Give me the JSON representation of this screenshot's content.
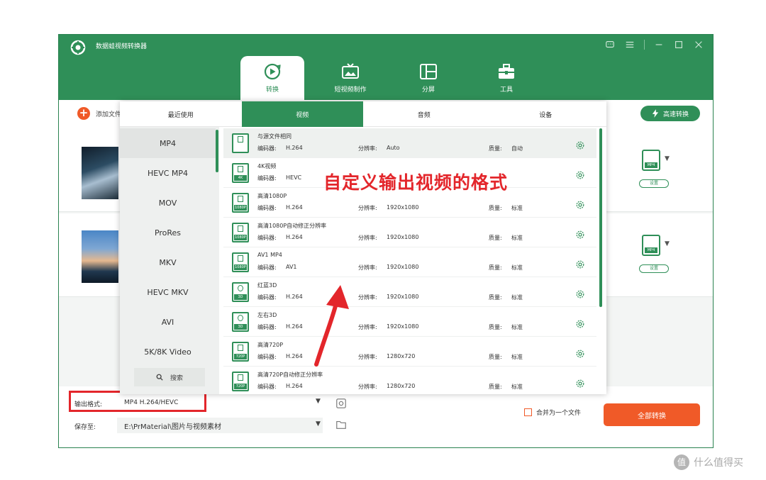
{
  "app": {
    "title": "数据蛙视频转换器"
  },
  "main_tabs": [
    {
      "label": "转换",
      "icon": "convert-icon",
      "active": true
    },
    {
      "label": "短视频制作",
      "icon": "tv-icon",
      "active": false
    },
    {
      "label": "分屏",
      "icon": "split-screen-icon",
      "active": false
    },
    {
      "label": "工具",
      "icon": "toolbox-icon",
      "active": false
    }
  ],
  "toolbar": {
    "add_file_label": "添加文件",
    "fast_convert_label": "高速转换"
  },
  "file_rows": [
    {
      "format_badge": "MP4",
      "settings_label": "设置"
    },
    {
      "format_badge": "MP4",
      "settings_label": "设置"
    }
  ],
  "panel": {
    "tabs": [
      {
        "label": "最近使用",
        "active": false
      },
      {
        "label": "视频",
        "active": true
      },
      {
        "label": "音频",
        "active": false
      },
      {
        "label": "设备",
        "active": false
      }
    ],
    "categories": [
      "MP4",
      "HEVC MP4",
      "MOV",
      "ProRes",
      "MKV",
      "HEVC MKV",
      "AVI",
      "5K/8K Video"
    ],
    "search_label": "搜索",
    "fields": {
      "encoder": "编码器:",
      "resolution": "分辨率:",
      "quality": "质量:"
    },
    "presets": [
      {
        "name": "与源文件相同",
        "badge": "",
        "encoder": "H.264",
        "resolution": "Auto",
        "quality": "自动"
      },
      {
        "name": "4K视频",
        "badge": "4K",
        "encoder": "HEVC",
        "resolution": "",
        "quality": ""
      },
      {
        "name": "高清1080P",
        "badge": "1080P",
        "encoder": "H.264",
        "resolution": "1920x1080",
        "quality": "标准"
      },
      {
        "name": "高清1080P自动修正分辨率",
        "badge": "1080P",
        "encoder": "H.264",
        "resolution": "1920x1080",
        "quality": "标准"
      },
      {
        "name": "AV1 MP4",
        "badge": "1080P",
        "encoder": "AV1",
        "resolution": "1920x1080",
        "quality": "标准"
      },
      {
        "name": "红蓝3D",
        "badge": "3D",
        "encoder": "H.264",
        "resolution": "1920x1080",
        "quality": "标准"
      },
      {
        "name": "左右3D",
        "badge": "3D",
        "encoder": "H.264",
        "resolution": "1920x1080",
        "quality": "标准"
      },
      {
        "name": "高清720P",
        "badge": "720P",
        "encoder": "H.264",
        "resolution": "1280x720",
        "quality": "标准"
      },
      {
        "name": "高清720P自动修正分辨率",
        "badge": "720P",
        "encoder": "H.264",
        "resolution": "1280x720",
        "quality": "标准"
      }
    ]
  },
  "annotation": "自定义输出视频的格式",
  "bottom": {
    "output_format_label": "输出格式:",
    "output_format_value": "MP4 H.264/HEVC",
    "save_to_label": "保存至:",
    "save_to_value": "E:\\PrMaterial\\图片与视频素材",
    "merge_label": "合并为一个文件",
    "convert_all_label": "全部转换"
  },
  "watermark": {
    "logo": "值",
    "text": "什么值得买"
  },
  "colors": {
    "brand_green": "#2f8f58",
    "accent_orange": "#f05a28",
    "annotation_red": "#e3262b"
  }
}
